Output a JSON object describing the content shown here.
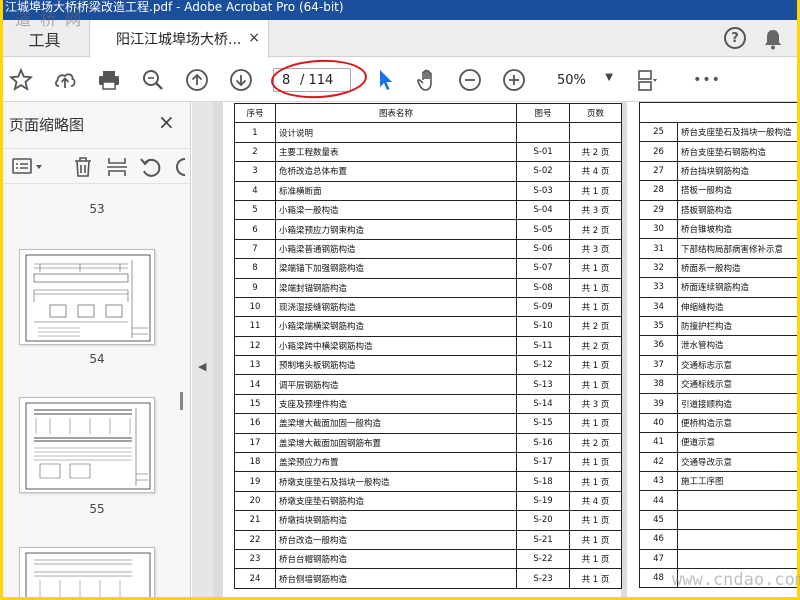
{
  "window": {
    "title": "江城埠场大桥桥梁改造工程.pdf - Adobe Acrobat Pro (64-bit)"
  },
  "watermark": {
    "top_left": "道 桥 网",
    "bottom_right": "www.cndao.com"
  },
  "tabs": {
    "tools": "工具",
    "document": "阳江江城埠场大桥...",
    "close": "×"
  },
  "toolbar": {
    "current_page": "8",
    "total_pages": "/ 114",
    "zoom": "50%",
    "more": "•••"
  },
  "left_panel": {
    "title": "页面缩略图",
    "close": "×",
    "thumbnails": [
      "53",
      "54",
      "55"
    ]
  },
  "table_left": {
    "headers": [
      "序号",
      "图表名称",
      "图号",
      "页数"
    ],
    "rows": [
      [
        "1",
        "设计说明",
        "",
        ""
      ],
      [
        "2",
        "主要工程数量表",
        "S-01",
        "共 2 页"
      ],
      [
        "3",
        "危桥改造总体布置",
        "S-02",
        "共 4 页"
      ],
      [
        "4",
        "标准横断面",
        "S-03",
        "共 1 页"
      ],
      [
        "5",
        "小箱梁一般构造",
        "S-04",
        "共 3 页"
      ],
      [
        "6",
        "小箱梁预应力钢束构造",
        "S-05",
        "共 2 页"
      ],
      [
        "7",
        "小箱梁普通钢筋构造",
        "S-06",
        "共 3 页"
      ],
      [
        "8",
        "梁端锚下加强钢筋构造",
        "S-07",
        "共 1 页"
      ],
      [
        "9",
        "梁端封锚钢筋构造",
        "S-08",
        "共 1 页"
      ],
      [
        "10",
        "现浇湿接缝钢筋构造",
        "S-09",
        "共 1 页"
      ],
      [
        "11",
        "小箱梁端横梁钢筋构造",
        "S-10",
        "共 2 页"
      ],
      [
        "12",
        "小箱梁跨中横梁钢筋构造",
        "S-11",
        "共 2 页"
      ],
      [
        "13",
        "预制堵头板钢筋构造",
        "S-12",
        "共 1 页"
      ],
      [
        "14",
        "调平层钢筋构造",
        "S-13",
        "共 1 页"
      ],
      [
        "15",
        "支座及预埋件构造",
        "S-14",
        "共 3 页"
      ],
      [
        "16",
        "盖梁增大截面加固一般构造",
        "S-15",
        "共 1 页"
      ],
      [
        "17",
        "盖梁增大截面加固钢筋布置",
        "S-16",
        "共 2 页"
      ],
      [
        "18",
        "盖梁预应力布置",
        "S-17",
        "共 1 页"
      ],
      [
        "19",
        "桥墩支座垫石及挡块一般构造",
        "S-18",
        "共 1 页"
      ],
      [
        "20",
        "桥墩支座垫石钢筋构造",
        "S-19",
        "共 4 页"
      ],
      [
        "21",
        "桥墩挡块钢筋构造",
        "S-20",
        "共 1 页"
      ],
      [
        "22",
        "桥台改造一般构造",
        "S-21",
        "共 1 页"
      ],
      [
        "23",
        "桥台台帽钢筋构造",
        "S-22",
        "共 1 页"
      ],
      [
        "24",
        "桥台侧墙钢筋构造",
        "S-23",
        "共 1 页"
      ]
    ]
  },
  "table_right": {
    "rows": [
      [
        "25",
        "桥台支座垫石及挡块一般构造"
      ],
      [
        "26",
        "桥台支座垫石钢筋构造"
      ],
      [
        "27",
        "桥台挡块钢筋构造"
      ],
      [
        "28",
        "搭板一般构造"
      ],
      [
        "29",
        "搭板钢筋构造"
      ],
      [
        "30",
        "桥台锥坡构造"
      ],
      [
        "31",
        "下部结构局部病害修补示意"
      ],
      [
        "32",
        "桥面系一般构造"
      ],
      [
        "33",
        "桥面连续钢筋构造"
      ],
      [
        "34",
        "伸缩缝构造"
      ],
      [
        "35",
        "防撞护栏构造"
      ],
      [
        "36",
        "泄水管构造"
      ],
      [
        "37",
        "交通标志示意"
      ],
      [
        "38",
        "交通标线示意"
      ],
      [
        "39",
        "引道接顺构造"
      ],
      [
        "40",
        "便桥构造示意"
      ],
      [
        "41",
        "便道示意"
      ],
      [
        "42",
        "交通导改示意"
      ],
      [
        "43",
        "施工工序图"
      ],
      [
        "44",
        ""
      ],
      [
        "45",
        ""
      ],
      [
        "46",
        ""
      ],
      [
        "47",
        ""
      ],
      [
        "48",
        ""
      ]
    ]
  },
  "colors": {
    "accent": "#1b4f9c",
    "highlight": "#e0121a",
    "frame": "#ffd400",
    "select_tool": "#1a73e8"
  }
}
